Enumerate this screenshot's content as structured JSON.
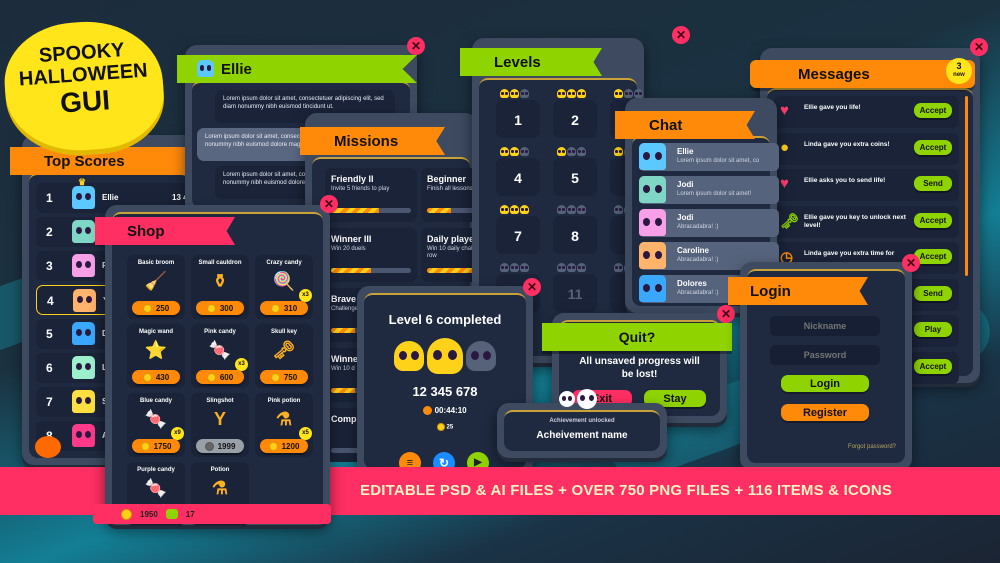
{
  "colors": {
    "orange": "#ff8a0a",
    "green": "#8fd400",
    "pink": "#ff2e63",
    "navy": "#1f2a40",
    "gold": "#ffcf1a"
  },
  "logo": {
    "lines": [
      "SPOOKY",
      "HALLOWEEN",
      "GUI"
    ]
  },
  "banner": {
    "text": "EDITABLE PSD & AI FILES + OVER 750 PNG FILES + 116 ITEMS & ICONS"
  },
  "top_scores": {
    "title": "Top Scores",
    "rows": [
      {
        "rank": "1",
        "name": "Ellie",
        "score": "13 4",
        "color": "#5bc8ff",
        "crown": true
      },
      {
        "rank": "2",
        "name": "",
        "color": "#7fd6c4"
      },
      {
        "rank": "3",
        "name": "R",
        "color": "#f7a0e8"
      },
      {
        "rank": "4",
        "name": "Y",
        "color": "#ffb36b",
        "highlight": true
      },
      {
        "rank": "5",
        "name": "D",
        "color": "#3aa8ff"
      },
      {
        "rank": "6",
        "name": "L",
        "color": "#9cf0cc"
      },
      {
        "rank": "7",
        "name": "S",
        "color": "#ffe040"
      },
      {
        "rank": "8",
        "name": "A",
        "color": "#ff3a8a"
      }
    ]
  },
  "ellie_chat": {
    "title": "Ellie",
    "messages": [
      "Lorem ipsum dolor sit amet, consectetuer adipiscing elit, sed diam nonummy nibh euismod tincidunt ut.",
      "Lorem ipsum dolor sit amet, consectetuer sed diam nonummy nibh euismod dolore magna aliquam erat volutpat.",
      "Lorem ipsum dolor sit amet, consectetuer sed diam nonummy nibh euismod dolore magna aliquam erat volutpat."
    ]
  },
  "missions": {
    "title": "Missions",
    "items": [
      {
        "name": "Friendly II",
        "desc": "Invite 5 friends to play",
        "progress": 0.6
      },
      {
        "name": "Beginner",
        "desc": "Finish all lessons mode",
        "progress": 0.3
      },
      {
        "name": "Winner III",
        "desc": "Win 20 duels",
        "progress": 0.5
      },
      {
        "name": "Daily player",
        "desc": "Win 10 daily challenges in a row",
        "progress": 1.0
      },
      {
        "name": "Brave",
        "desc": "Challenge",
        "progress": 0.3
      },
      {
        "name": "Winner",
        "desc": "Win 10 d",
        "progress": 0.3
      },
      {
        "name": "Complete",
        "desc": "",
        "progress": 0
      }
    ]
  },
  "shop": {
    "title": "Shop",
    "items": [
      {
        "name": "Basic broom",
        "price": "250",
        "icon": "broom-icon",
        "glyph": "🧹"
      },
      {
        "name": "Small cauldron",
        "price": "300",
        "icon": "cauldron-icon",
        "glyph": "⚱"
      },
      {
        "name": "Crazy candy",
        "price": "310",
        "badge": "x3",
        "icon": "lollipop-icon",
        "glyph": "🍭"
      },
      {
        "name": "Magic wand",
        "price": "430",
        "icon": "wand-icon",
        "glyph": "⭐"
      },
      {
        "name": "Pink candy",
        "price": "600",
        "badge": "x3",
        "icon": "candy-icon",
        "glyph": "🍬"
      },
      {
        "name": "Skull key",
        "price": "750",
        "icon": "skull-key-icon",
        "glyph": "🗝"
      },
      {
        "name": "Blue candy",
        "price": "1750",
        "badge": "x9",
        "icon": "candy-icon",
        "glyph": "🍬"
      },
      {
        "name": "Slingshot",
        "price": "1999",
        "disabled": true,
        "icon": "slingshot-icon",
        "glyph": "Y"
      },
      {
        "name": "Pink potion",
        "price": "1200",
        "badge": "x5",
        "icon": "potion-icon",
        "glyph": "⚗"
      },
      {
        "name": "Purple candy",
        "price": "",
        "icon": "candy-icon",
        "glyph": "🍬"
      },
      {
        "name": "Potion",
        "price": "",
        "icon": "potion-icon",
        "glyph": "⚗"
      }
    ],
    "coins": "1950",
    "gems": "17"
  },
  "levels": {
    "title": "Levels",
    "cells": [
      {
        "number": "1",
        "skulls": 2
      },
      {
        "number": "2",
        "skulls": 3
      },
      {
        "number": "",
        "skulls": 1
      },
      {
        "number": "4",
        "skulls": 2
      },
      {
        "number": "5",
        "skulls": 1
      },
      {
        "number": "",
        "skulls": 1
      },
      {
        "number": "7",
        "skulls": 3
      },
      {
        "number": "8",
        "skulls": 0
      },
      {
        "number": "",
        "skulls": 0
      },
      {
        "number": "",
        "skulls": 0
      },
      {
        "number": "11",
        "skulls": 0,
        "locked": true
      },
      {
        "number": "",
        "skulls": 0
      }
    ]
  },
  "chat": {
    "title": "Chat",
    "items": [
      {
        "name": "Ellie",
        "text": "Lorem ipsum dolor sit amet, co",
        "color": "#5bc8ff"
      },
      {
        "name": "Jodi",
        "text": "Lorem ipsum dolor sit amet!",
        "color": "#7fd6c4"
      },
      {
        "name": "Jodi",
        "text": "Abracadabra! :)",
        "color": "#f7a0e8"
      },
      {
        "name": "Caroline",
        "text": "Abracadabra! :)",
        "color": "#ffb36b"
      },
      {
        "name": "Dolores",
        "text": "Abracadabra! :)",
        "color": "#3aa8ff"
      }
    ]
  },
  "messages": {
    "title": "Messages",
    "badge_count": "3",
    "badge_label": "new",
    "items": [
      {
        "text": "Ellie gave you life!",
        "button": "Accept",
        "icon": "heart-icon",
        "glyph": "♥",
        "glyph_color": "#ff3d6e"
      },
      {
        "text": "Linda gave you extra coins!",
        "button": "Accept",
        "icon": "coin-icon",
        "glyph": "●",
        "glyph_color": "#ffcf1a"
      },
      {
        "text": "Ellie asks you to send life!",
        "button": "Send",
        "icon": "heart-icon",
        "glyph": "♥",
        "glyph_color": "#ff3d6e"
      },
      {
        "text": "Ellie gave you key to unlock next level!",
        "button": "Accept",
        "icon": "skull-key-icon",
        "glyph": "🗝",
        "glyph_color": "#8fd400"
      },
      {
        "text": "Linda gave you extra time for",
        "button": "Accept",
        "icon": "clock-icon",
        "glyph": "◷",
        "glyph_color": "#ff8a0a"
      },
      {
        "text": "",
        "button": "Send"
      },
      {
        "text": "",
        "button": "Play"
      },
      {
        "text": "",
        "button": "Accept"
      }
    ]
  },
  "level_complete": {
    "title": "Level 6 completed",
    "skulls_earned": 2,
    "skulls_total": 3,
    "score": "12 345 678",
    "time": "00:44:10",
    "coins": "25"
  },
  "quit": {
    "title": "Quit?",
    "message": "All unsaved progress will be lost!",
    "exit": "Exit",
    "stay": "Stay"
  },
  "achievement": {
    "label": "Achievement unlocked",
    "name": "Acheivement name"
  },
  "login": {
    "title": "Login",
    "nickname_placeholder": "Nickname",
    "password_placeholder": "Password",
    "login": "Login",
    "register": "Register",
    "forgot": "Forgot password?"
  }
}
